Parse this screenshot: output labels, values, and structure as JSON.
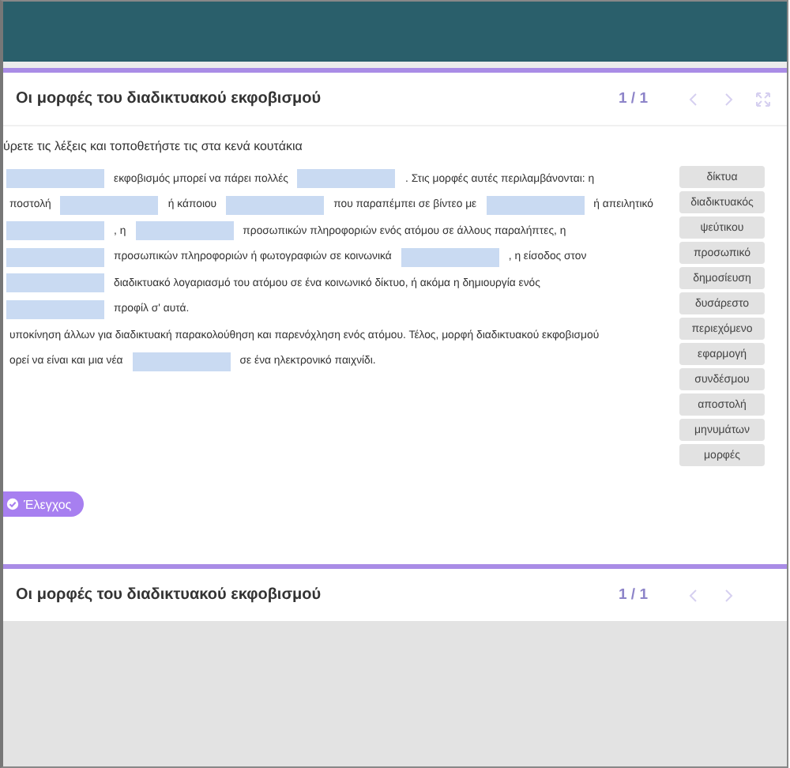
{
  "panels": [
    {
      "title": "Οι μορφές του διαδικτυακού εκφοβισμού",
      "counter": "1 / 1",
      "expanded": true,
      "instruction": "ύρετε τις λέξεις και τοποθετήστε τις στα κενά κουτάκια",
      "lines": [
        [
          {
            "kind": "blank"
          },
          {
            "kind": "text",
            "text": "εκφοβισμός μπορεί να πάρει πολλές"
          },
          {
            "kind": "blank"
          },
          {
            "kind": "text",
            "text": ". Στις μορφές αυτές περιλαμβάνονται: η"
          }
        ],
        [
          {
            "kind": "text",
            "text": "ποστολή"
          },
          {
            "kind": "blank"
          },
          {
            "kind": "text",
            "text": "ή κάποιου"
          },
          {
            "kind": "blank"
          },
          {
            "kind": "text",
            "text": "που παραπέμπει σε βίντεο με"
          },
          {
            "kind": "blank"
          },
          {
            "kind": "text",
            "text": "ή απειλητικό"
          }
        ],
        [
          {
            "kind": "blank"
          },
          {
            "kind": "text",
            "text": ", η"
          },
          {
            "kind": "blank"
          },
          {
            "kind": "text",
            "text": "προσωπικών πληροφοριών ενός ατόμου σε άλλους παραλήπτες, η"
          }
        ],
        [
          {
            "kind": "blank"
          },
          {
            "kind": "text",
            "text": "προσωπικών πληροφοριών ή φωτογραφιών σε κοινωνικά"
          },
          {
            "kind": "blank"
          },
          {
            "kind": "text",
            "text": ", η είσοδος στον"
          }
        ],
        [
          {
            "kind": "blank"
          },
          {
            "kind": "text",
            "text": "διαδικτυακό λογαριασμό του ατόμου σε ένα κοινωνικό δίκτυο, ή ακόμα η δημιουργία ενός"
          }
        ],
        [
          {
            "kind": "blank"
          },
          {
            "kind": "text",
            "text": "προφίλ σ' αυτά."
          }
        ],
        [
          {
            "kind": "text",
            "text": "υποκίνηση άλλων για διαδικτυακή παρακολούθηση και παρενόχληση ενός ατόμου. Τέλος, μορφή διαδικτυακού εκφοβισμού"
          }
        ],
        [
          {
            "kind": "text",
            "text": "ορεί να είναι και μια νέα"
          },
          {
            "kind": "blank"
          },
          {
            "kind": "text",
            "text": "σε ένα ηλεκτρονικό παιχνίδι."
          }
        ]
      ],
      "words": [
        "δίκτυα",
        "διαδικτυακός",
        "ψεύτικου",
        "προσωπικό",
        "δημοσίευση",
        "δυσάρεστο",
        "περιεχόμενο",
        "εφαρμογή",
        "συνδέσμου",
        "αποστολή",
        "μηνυμάτων",
        "μορφές"
      ],
      "check_button": "Έλεγχος"
    },
    {
      "title": "Οι μορφές του διαδικτυακού εκφοβισμού",
      "counter": "1 / 1",
      "expanded": false
    }
  ]
}
